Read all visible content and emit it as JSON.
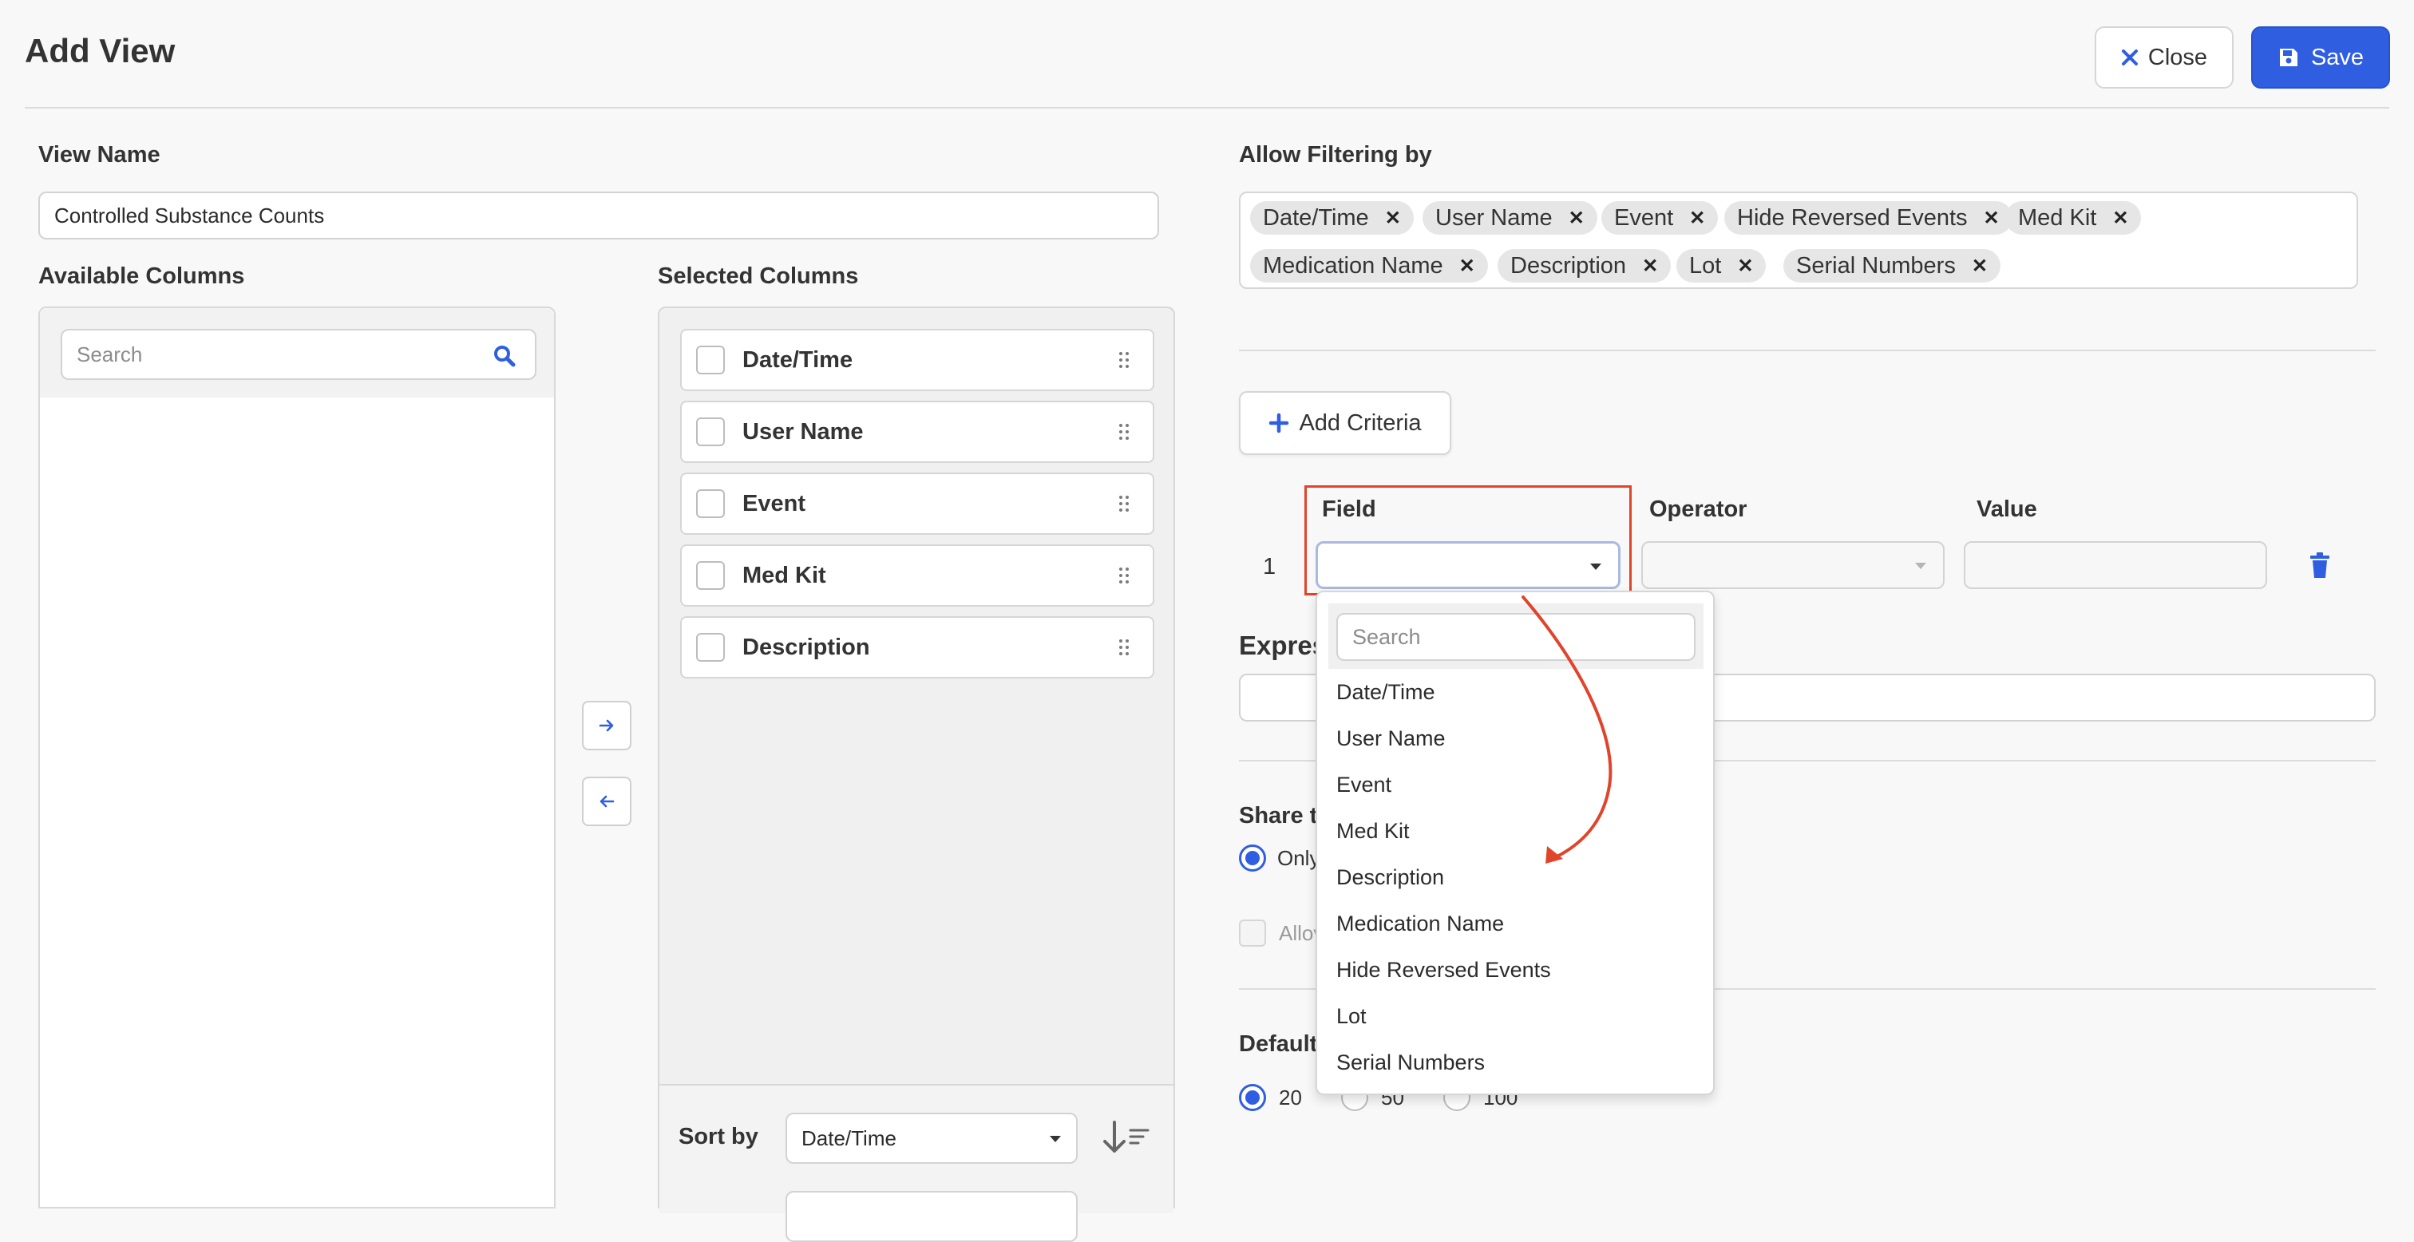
{
  "header": {
    "title": "Add View",
    "close_label": "Close",
    "save_label": "Save"
  },
  "view_name": {
    "label": "View Name",
    "value": "Controlled Substance Counts"
  },
  "available_columns": {
    "label": "Available Columns",
    "search_placeholder": "Search"
  },
  "selected_columns": {
    "label": "Selected Columns",
    "items": [
      "Date/Time",
      "User Name",
      "Event",
      "Med Kit",
      "Description"
    ]
  },
  "sort": {
    "label": "Sort by",
    "value": "Date/Time"
  },
  "filtering": {
    "label": "Allow Filtering by",
    "chips": [
      "Date/Time",
      "User Name",
      "Event",
      "Hide Reversed Events",
      "Med Kit",
      "Medication Name",
      "Description",
      "Lot",
      "Serial Numbers"
    ]
  },
  "criteria": {
    "add_label": "Add Criteria",
    "headers": {
      "field": "Field",
      "operator": "Operator",
      "value": "Value"
    },
    "row_number": "1"
  },
  "field_dropdown": {
    "search_placeholder": "Search",
    "options": [
      "Date/Time",
      "User Name",
      "Event",
      "Med Kit",
      "Description",
      "Medication Name",
      "Hide Reversed Events",
      "Lot",
      "Serial Numbers"
    ]
  },
  "expression": {
    "label_partial": "Expres"
  },
  "share": {
    "label_partial": "Share t",
    "option_partial": "Only",
    "allow_partial": "Allov"
  },
  "default": {
    "label_partial": "Default",
    "page_sizes": [
      "20",
      "50",
      "100"
    ],
    "selected": "20"
  },
  "colors": {
    "accent": "#2f5fe0",
    "highlight": "#e0442b"
  }
}
